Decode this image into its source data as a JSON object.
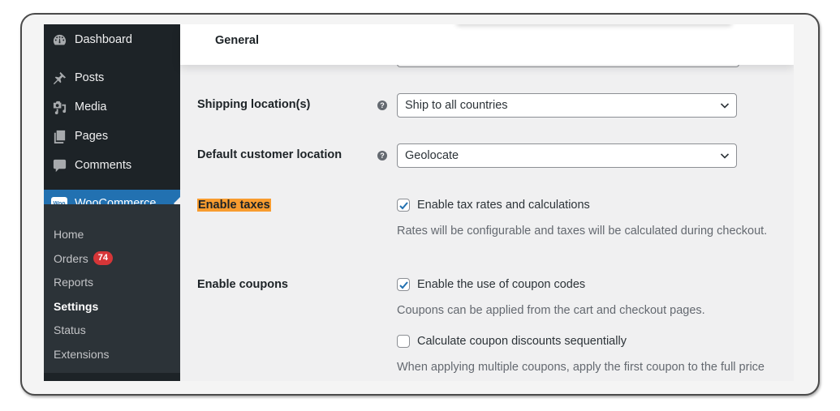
{
  "sidebar": {
    "items": [
      {
        "label": "Dashboard",
        "icon": "dashboard-icon"
      },
      {
        "label": "Posts",
        "icon": "pin-icon"
      },
      {
        "label": "Media",
        "icon": "media-icon"
      },
      {
        "label": "Pages",
        "icon": "pages-icon"
      },
      {
        "label": "Comments",
        "icon": "comment-icon"
      },
      {
        "label": "WooCommerce",
        "icon": "woo-icon",
        "logo_text": "Woo"
      }
    ],
    "submenu": [
      {
        "label": "Home"
      },
      {
        "label": "Orders",
        "badge": "74"
      },
      {
        "label": "Reports"
      },
      {
        "label": "Settings"
      },
      {
        "label": "Status"
      },
      {
        "label": "Extensions"
      }
    ]
  },
  "header": {
    "tab": "General"
  },
  "settings": {
    "shipping": {
      "label": "Shipping location(s)",
      "help": "?",
      "value": "Ship to all countries"
    },
    "customer_location": {
      "label": "Default customer location",
      "help": "?",
      "value": "Geolocate"
    },
    "taxes": {
      "label": "Enable taxes",
      "checkbox_label": "Enable tax rates and calculations",
      "checked": true,
      "description": "Rates will be configurable and taxes will be calculated during checkout."
    },
    "coupons": {
      "label": "Enable coupons",
      "checkbox_label": "Enable the use of coupon codes",
      "checked": true,
      "description": "Coupons can be applied from the cart and checkout pages.",
      "sequential_label": "Calculate coupon discounts sequentially",
      "sequential_checked": false,
      "sequential_description": "When applying multiple coupons, apply the first coupon to the full price"
    }
  },
  "colors": {
    "sidebar_bg": "#1d2327",
    "submenu_bg": "#2c3338",
    "accent": "#2271b1",
    "badge": "#d63638",
    "highlight": "#f89c2f"
  }
}
